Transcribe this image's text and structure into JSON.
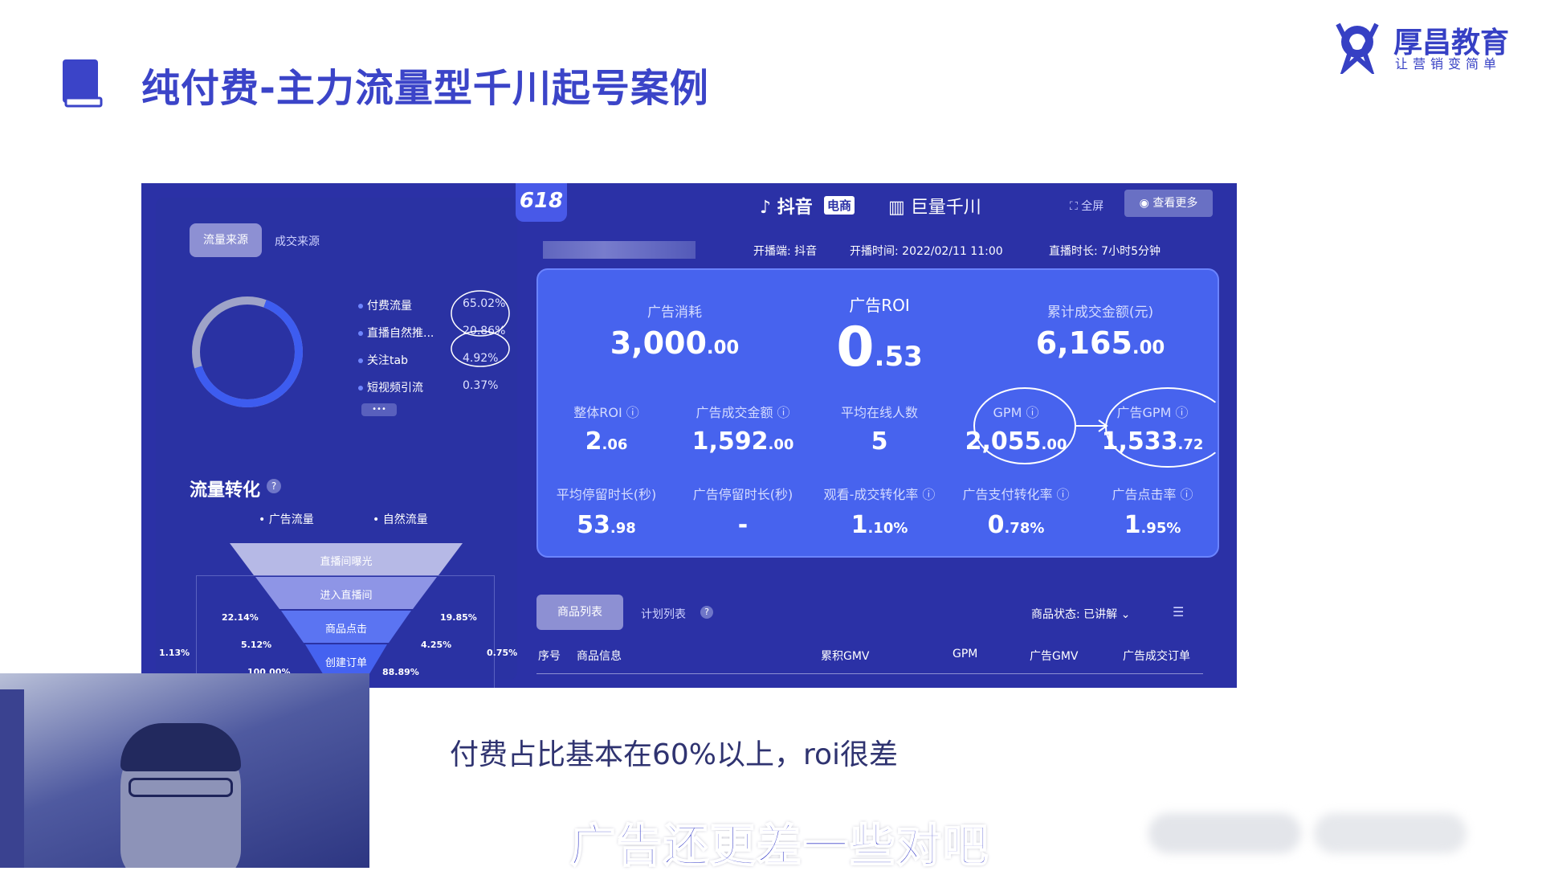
{
  "slide": {
    "title": "纯付费-主力流量型千川起号案例",
    "logo_name": "厚昌教育",
    "logo_slogan": "让营销变简单"
  },
  "dashboard": {
    "badge": "618",
    "douyin_label": "抖音",
    "douyin_tag": "电商",
    "qianchuan_label": "巨量千川",
    "fullscreen_label": "全屏",
    "view_more_label": "查看更多",
    "live_platform": "开播端: 抖音",
    "live_start": "开播时间: 2022/02/11 11:00",
    "live_duration": "直播时长: 7小时5分钟",
    "left": {
      "tab_traffic_source": "流量来源",
      "tab_deal_source": "成交来源",
      "legend": [
        {
          "label": "付费流量",
          "pct": "65.02%"
        },
        {
          "label": "直播自然推...",
          "pct": "20.86%"
        },
        {
          "label": "关注tab",
          "pct": "4.92%"
        },
        {
          "label": "短视频引流",
          "pct": "0.37%"
        }
      ],
      "legend_more": "•••",
      "funnel_title": "流量转化",
      "legend_ad": "广告流量",
      "legend_natural": "自然流量",
      "funnel_levels": [
        "直播间曝光",
        "进入直播间",
        "商品点击",
        "创建订单"
      ],
      "funnel_pcts": {
        "l1": "22.14%",
        "r1": "19.85%",
        "l2": "5.12%",
        "r2": "4.25%",
        "l3": "1.13%",
        "r3": "0.75%",
        "l4": "100.00%",
        "r4": "88.89%"
      }
    },
    "metrics": {
      "top": [
        {
          "label": "广告消耗",
          "int": "3,000",
          "dec": ".00"
        },
        {
          "label": "广告ROI",
          "int": "0",
          "dec": ".53"
        },
        {
          "label": "累计成交金额(元)",
          "int": "6,165",
          "dec": ".00"
        }
      ],
      "row2": [
        {
          "label": "整体ROI",
          "int": "2",
          "dec": ".06"
        },
        {
          "label": "广告成交金额",
          "int": "1,592",
          "dec": ".00"
        },
        {
          "label": "平均在线人数",
          "int": "5",
          "dec": ""
        },
        {
          "label": "GPM",
          "int": "2,055",
          "dec": ".00"
        },
        {
          "label": "广告GPM",
          "int": "1,533",
          "dec": ".72"
        }
      ],
      "row3": [
        {
          "label": "平均停留时长(秒)",
          "int": "53",
          "dec": ".98"
        },
        {
          "label": "广告停留时长(秒)",
          "int": "-",
          "dec": ""
        },
        {
          "label": "观看-成交转化率",
          "int": "1",
          "dec": ".10%"
        },
        {
          "label": "广告支付转化率",
          "int": "0",
          "dec": ".78%"
        },
        {
          "label": "广告点击率",
          "int": "1",
          "dec": ".95%"
        }
      ]
    },
    "table": {
      "tab_product_list": "商品列表",
      "tab_plan_list": "计划列表",
      "product_status": "商品状态: 已讲解 ⌄",
      "headers": [
        "序号",
        "商品信息",
        "累积GMV",
        "GPM",
        "广告GMV",
        "广告成交订单"
      ]
    }
  },
  "captions": {
    "note": "付费占比基本在60%以上，roi很差",
    "subtitle": "广告还更差一些对吧"
  }
}
